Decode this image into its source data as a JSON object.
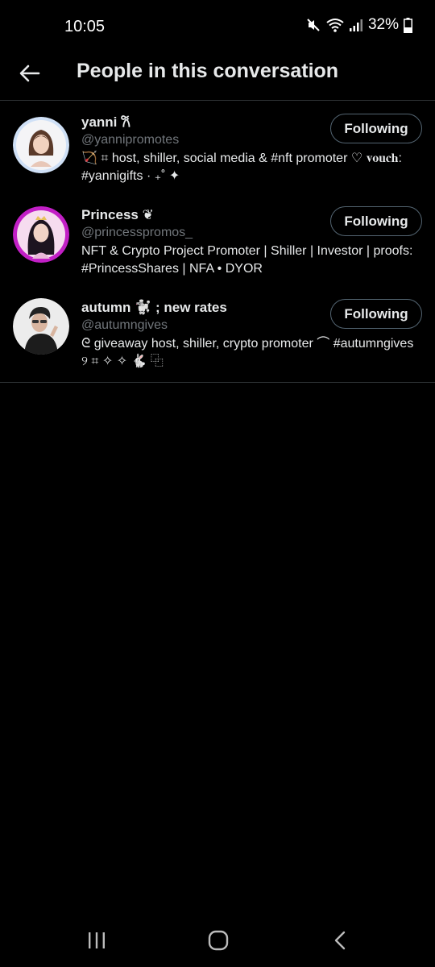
{
  "status_bar": {
    "time": "10:05",
    "battery": "32%",
    "icons": [
      "mute-icon",
      "wifi-icon",
      "signal-icon",
      "battery-icon"
    ]
  },
  "header": {
    "title": "People in this conversation",
    "back_icon": "arrow-left-icon"
  },
  "people": [
    {
      "name": "yanni 𐙚",
      "handle": "@yannipromotes",
      "bio": "🏹 ⌗ host, shiller, social media & #nft promoter ♡ 𝐯𝐨𝐮𝐜𝐡: #yannigifts · ₊˚ ✦",
      "button": "Following"
    },
    {
      "name": "Princess ❦",
      "handle": "@princesspromos_",
      "bio": "NFT & Crypto Project Promoter | Shiller | Investor | proofs: #PrincessShares | NFA • DYOR",
      "button": "Following"
    },
    {
      "name": "autumn 🐩 ; new rates",
      "handle": "@autumngives",
      "bio": "ᘓ giveaway host, shiller, crypto promoter ⌒ #autumngives ୨ ⌗ ✧ ✧ 🐇 ⿻",
      "button": "Following"
    }
  ],
  "nav_bar": {
    "icons": [
      "recent-apps-icon",
      "home-icon",
      "back-icon"
    ]
  },
  "colors": {
    "background": "#000000",
    "text": "#e7e9ea",
    "secondary_text": "#71767b",
    "divider": "#2f3336",
    "button_border": "#536471"
  }
}
